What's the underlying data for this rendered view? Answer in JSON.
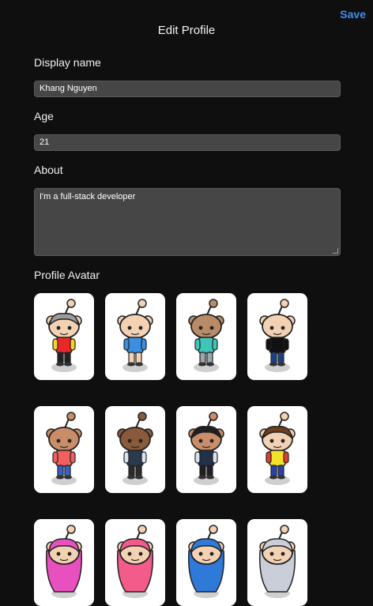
{
  "header": {
    "title": "Edit Profile",
    "save_label": "Save"
  },
  "form": {
    "display_name": {
      "label": "Display name",
      "value": "Khang Nguyen"
    },
    "age": {
      "label": "Age",
      "value": "21"
    },
    "about": {
      "label": "About",
      "value": "I'm a full-stack developer"
    }
  },
  "avatars": {
    "label": "Profile Avatar",
    "items": [
      {
        "name": "avatar-gray-hair-red-yellow",
        "skin": "#f3d2b3",
        "hair": "#9a9a9a",
        "shirt": "#e9272b",
        "accent": "#f7d21e",
        "pants": "#222222"
      },
      {
        "name": "avatar-winking-blue-shirt",
        "skin": "#f3d2b3",
        "hair": "none",
        "shirt": "#3a8fe0",
        "accent": "#3a8fe0",
        "pants": "#f3d2b3"
      },
      {
        "name": "avatar-tan-teal-shirt",
        "skin": "#b98b66",
        "hair": "none",
        "shirt": "#3fc6b9",
        "accent": "#3fc6b9",
        "pants": "#9aa7ad"
      },
      {
        "name": "avatar-black-shirt-jeans",
        "skin": "#f3d2b3",
        "hair": "none",
        "shirt": "#111111",
        "accent": "#111111",
        "pants": "#1d3f8a"
      },
      {
        "name": "avatar-salmon-shirt",
        "skin": "#c98d6a",
        "hair": "none",
        "shirt": "#f25f5c",
        "accent": "#f25f5c",
        "pants": "#3a5fbf"
      },
      {
        "name": "avatar-dark-suit",
        "skin": "#8a5a3c",
        "hair": "none",
        "shirt": "#2b3a4f",
        "accent": "#d7e3ee",
        "pants": "#2b2b2b"
      },
      {
        "name": "avatar-black-hair-suit",
        "skin": "#c98d6a",
        "hair": "#1f1f1f",
        "shirt": "#23304a",
        "accent": "#d7e3ee",
        "pants": "#1f1f1f"
      },
      {
        "name": "avatar-brown-hair-yellow-shirt",
        "skin": "#f3d2b3",
        "hair": "#6b3f20",
        "shirt": "#f4e12a",
        "accent": "#e33d2d",
        "pants": "#2743a6"
      },
      {
        "name": "avatar-pink-hair",
        "skin": "#f3d2b3",
        "hair": "#e84fbf",
        "shirt": "#e84fbf",
        "accent": "#e84fbf",
        "pants": "#e84fbf"
      },
      {
        "name": "avatar-pink-hair-2",
        "skin": "#f3d2b3",
        "hair": "#f25b8a",
        "shirt": "#f25b8a",
        "accent": "#f25b8a",
        "pants": "#f25b8a"
      },
      {
        "name": "avatar-blue-hair",
        "skin": "#f3d2b3",
        "hair": "#2f79d8",
        "shirt": "#2f79d8",
        "accent": "#2f79d8",
        "pants": "#2f79d8"
      },
      {
        "name": "avatar-silver-hair",
        "skin": "#f3d2b3",
        "hair": "#c9ced8",
        "shirt": "#c9ced8",
        "accent": "#c9ced8",
        "pants": "#c9ced8"
      }
    ]
  }
}
